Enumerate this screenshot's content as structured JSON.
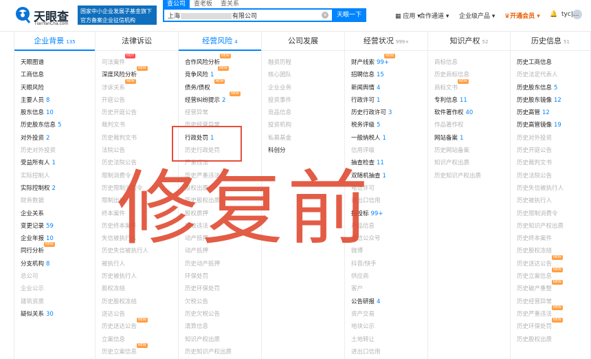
{
  "header": {
    "brand": "天眼查",
    "brand_url": "TianYanCha.com",
    "gov_line1": "国家中小企业发展子基金旗下",
    "gov_line2": "官方备案企业征信机构",
    "search_tabs": [
      "查公司",
      "查老板",
      "查关系"
    ],
    "search_prefix": "上海",
    "search_suffix": "有限公司",
    "search_button": "天眼一下",
    "nav": [
      "应用",
      "合作通道",
      "企业级产品",
      "开通会员",
      "tyc|..."
    ]
  },
  "columns": [
    {
      "title": "企业背景",
      "count": "135",
      "active": true,
      "items": [
        {
          "label": "天眼图谱",
          "on": true
        },
        {
          "label": "工商信息",
          "on": true
        },
        {
          "label": "天眼风险",
          "on": true
        },
        {
          "label": "主要人员",
          "count": "8",
          "on": true
        },
        {
          "label": "股东信息",
          "count": "10",
          "on": true
        },
        {
          "label": "历史股东信息",
          "count": "5",
          "on": true
        },
        {
          "label": "对外投资",
          "count": "2",
          "on": true
        },
        {
          "label": "历史对外投资",
          "on": false
        },
        {
          "label": "受益所有人",
          "count": "1",
          "on": true
        },
        {
          "label": "实际控制人",
          "on": false
        },
        {
          "label": "实际控制权",
          "count": "2",
          "on": true
        },
        {
          "label": "财务数据",
          "on": false
        },
        {
          "label": "企业关系",
          "on": true
        },
        {
          "label": "变更记录",
          "count": "59",
          "on": true
        },
        {
          "label": "企业年报",
          "count": "10",
          "on": true
        },
        {
          "label": "同行分析",
          "on": true,
          "badge": "NEW"
        },
        {
          "label": "分支机构",
          "count": "8",
          "on": true
        },
        {
          "label": "总公司",
          "on": false
        },
        {
          "label": "企业公示",
          "on": false
        },
        {
          "label": "建筑资质",
          "on": false
        },
        {
          "label": "疑似关系",
          "count": "30",
          "on": true
        }
      ]
    },
    {
      "title": "法律诉讼",
      "count": "",
      "active": false,
      "items": [
        {
          "label": "司法案件",
          "on": false,
          "badge": "HOT"
        },
        {
          "label": "深度风险分析",
          "on": true,
          "badge": "NEW"
        },
        {
          "label": "涉诉关系",
          "on": false,
          "badge": "NEW"
        },
        {
          "label": "开庭公告",
          "on": false
        },
        {
          "label": "历史开庭公告",
          "on": false
        },
        {
          "label": "裁判文书",
          "on": false
        },
        {
          "label": "历史裁判文书",
          "on": false
        },
        {
          "label": "法院公告",
          "on": false
        },
        {
          "label": "历史法院公告",
          "on": false
        },
        {
          "label": "限制消费令",
          "on": false
        },
        {
          "label": "历史限制消费令",
          "on": false
        },
        {
          "label": "限制出境",
          "on": false
        },
        {
          "label": "终本案件",
          "on": false
        },
        {
          "label": "历史终本案件",
          "on": false
        },
        {
          "label": "失信被执行人",
          "on": false
        },
        {
          "label": "历史失信被执行人",
          "on": false
        },
        {
          "label": "被执行人",
          "on": false
        },
        {
          "label": "历史被执行人",
          "on": false
        },
        {
          "label": "股权冻结",
          "on": false
        },
        {
          "label": "历史股权冻结",
          "on": false
        },
        {
          "label": "送达公告",
          "on": false
        },
        {
          "label": "历史送达公告",
          "on": false,
          "badge": "NEW"
        },
        {
          "label": "立案信息",
          "on": false
        },
        {
          "label": "历史立案信息",
          "on": false,
          "badge": "NEW"
        }
      ]
    },
    {
      "title": "经营风险",
      "count": "4",
      "active": true,
      "items": [
        {
          "label": "合作风险分析",
          "on": true,
          "badge": "NEW"
        },
        {
          "label": "竞争风险",
          "count": "1",
          "on": true,
          "badge": "NEW"
        },
        {
          "label": "债务/债权",
          "on": true,
          "badge": "NEW"
        },
        {
          "label": "经营纠纷提示",
          "count": "2",
          "on": true,
          "badge": "NEW"
        },
        {
          "label": "经营异常",
          "on": false
        },
        {
          "label": "历史经营异常",
          "on": false
        },
        {
          "label": "行政处罚",
          "count": "1",
          "on": true
        },
        {
          "label": "历史行政处罚",
          "on": false
        },
        {
          "label": "严重违法",
          "on": false
        },
        {
          "label": "历史严重违法",
          "on": false
        },
        {
          "label": "股权出质",
          "on": false
        },
        {
          "label": "历史股权出质",
          "on": false
        },
        {
          "label": "股权质押",
          "on": false
        },
        {
          "label": "税收违法",
          "on": false
        },
        {
          "label": "动产抵押",
          "on": false
        },
        {
          "label": "动产抵押",
          "on": false
        },
        {
          "label": "历史动产抵押",
          "on": false
        },
        {
          "label": "环保处罚",
          "on": false
        },
        {
          "label": "历史环保处罚",
          "on": false
        },
        {
          "label": "欠税公告",
          "on": false
        },
        {
          "label": "历史欠税公告",
          "on": false
        },
        {
          "label": "清算信息",
          "on": false
        },
        {
          "label": "知识产权出质",
          "on": false
        },
        {
          "label": "历史知识产权出质",
          "on": false
        }
      ]
    },
    {
      "title": "公司发展",
      "count": "",
      "active": false,
      "items": [
        {
          "label": "融资历程",
          "on": false
        },
        {
          "label": "核心团队",
          "on": false
        },
        {
          "label": "企业业务",
          "on": false
        },
        {
          "label": "投资事件",
          "on": false
        },
        {
          "label": "竞品信息",
          "on": false
        },
        {
          "label": "投资机构",
          "on": false
        },
        {
          "label": "私募基金",
          "on": false
        },
        {
          "label": "科创分",
          "on": true
        }
      ]
    },
    {
      "title": "经营状况",
      "count": "999+",
      "active": false,
      "items": [
        {
          "label": "财产线索",
          "count": "99+",
          "on": true,
          "badge": "NEW"
        },
        {
          "label": "招聘信息",
          "count": "15",
          "on": true
        },
        {
          "label": "新闻舆情",
          "count": "4",
          "on": true
        },
        {
          "label": "行政许可",
          "count": "1",
          "on": true
        },
        {
          "label": "历史行政许可",
          "count": "3",
          "on": true
        },
        {
          "label": "税务评级",
          "count": "5",
          "on": true
        },
        {
          "label": "一般纳税人",
          "count": "1",
          "on": true
        },
        {
          "label": "信用评级",
          "on": false
        },
        {
          "label": "抽查检查",
          "count": "11",
          "on": true
        },
        {
          "label": "双随机抽查",
          "count": "1",
          "on": true
        },
        {
          "label": "电信许可",
          "on": false
        },
        {
          "label": "进出口信用",
          "on": false
        },
        {
          "label": "招投标",
          "count": "99+",
          "on": true
        },
        {
          "label": "产品信息",
          "on": false
        },
        {
          "label": "微信公众号",
          "on": false
        },
        {
          "label": "微博",
          "on": false
        },
        {
          "label": "抖音/快手",
          "on": false
        },
        {
          "label": "供应商",
          "on": false
        },
        {
          "label": "客户",
          "on": false
        },
        {
          "label": "公告研报",
          "count": "4",
          "on": true
        },
        {
          "label": "资产交易",
          "on": false
        },
        {
          "label": "地块公示",
          "on": false
        },
        {
          "label": "土地转让",
          "on": false
        },
        {
          "label": "进出口信用",
          "on": false
        },
        {
          "label": "债券信息",
          "on": false
        }
      ]
    },
    {
      "title": "知识产权",
      "count": "52",
      "active": false,
      "items": [
        {
          "label": "商标信息",
          "on": false
        },
        {
          "label": "历史商标信息",
          "on": false
        },
        {
          "label": "商标文书",
          "on": false,
          "badge": "NEW"
        },
        {
          "label": "专利信息",
          "count": "11",
          "on": true
        },
        {
          "label": "软件著作权",
          "count": "40",
          "on": true
        },
        {
          "label": "作品著作权",
          "on": false
        },
        {
          "label": "网站备案",
          "count": "1",
          "on": true
        },
        {
          "label": "历史网站备案",
          "on": false
        },
        {
          "label": "知识产权出质",
          "on": false
        },
        {
          "label": "历史知识产权出质",
          "on": false
        }
      ]
    },
    {
      "title": "历史信息",
      "count": "51",
      "active": false,
      "items": [
        {
          "label": "历史工商信息",
          "on": true
        },
        {
          "label": "历史法定代表人",
          "on": false
        },
        {
          "label": "历史股东信息",
          "count": "5",
          "on": true
        },
        {
          "label": "历史股东镜像",
          "count": "12",
          "on": true
        },
        {
          "label": "历史高管",
          "count": "12",
          "on": true
        },
        {
          "label": "历史高管镜像",
          "count": "19",
          "on": true
        },
        {
          "label": "历史对外投资",
          "on": false
        },
        {
          "label": "历史开庭公告",
          "on": false
        },
        {
          "label": "历史裁判文书",
          "on": false
        },
        {
          "label": "历史法院公告",
          "on": false
        },
        {
          "label": "历史失信被执行人",
          "on": false
        },
        {
          "label": "历史被执行人",
          "on": false
        },
        {
          "label": "历史限制消费令",
          "on": false
        },
        {
          "label": "历史知识产权出质",
          "on": false
        },
        {
          "label": "历史终本案件",
          "on": false
        },
        {
          "label": "历史股权冻结",
          "on": false
        },
        {
          "label": "历史送达公告",
          "on": false,
          "badge": "NEW"
        },
        {
          "label": "历史立案信息",
          "on": false,
          "badge": "NEW"
        },
        {
          "label": "历史破产重整",
          "on": false,
          "badge": "NEW"
        },
        {
          "label": "历史经营异常",
          "on": false
        },
        {
          "label": "历史严重违法",
          "on": false,
          "badge": "NEW"
        },
        {
          "label": "历史环保处罚",
          "on": false,
          "badge": "NEW"
        },
        {
          "label": "历史股权出质",
          "on": false
        }
      ]
    }
  ],
  "watermark": "修复前",
  "colors": {
    "accent": "#0084ff",
    "count": "#0084ff",
    "disabled": "#b4b4b4",
    "badge_new": "#ff9f43",
    "badge_hot": "#ff4d4f",
    "annotation": "#e74c3c"
  }
}
